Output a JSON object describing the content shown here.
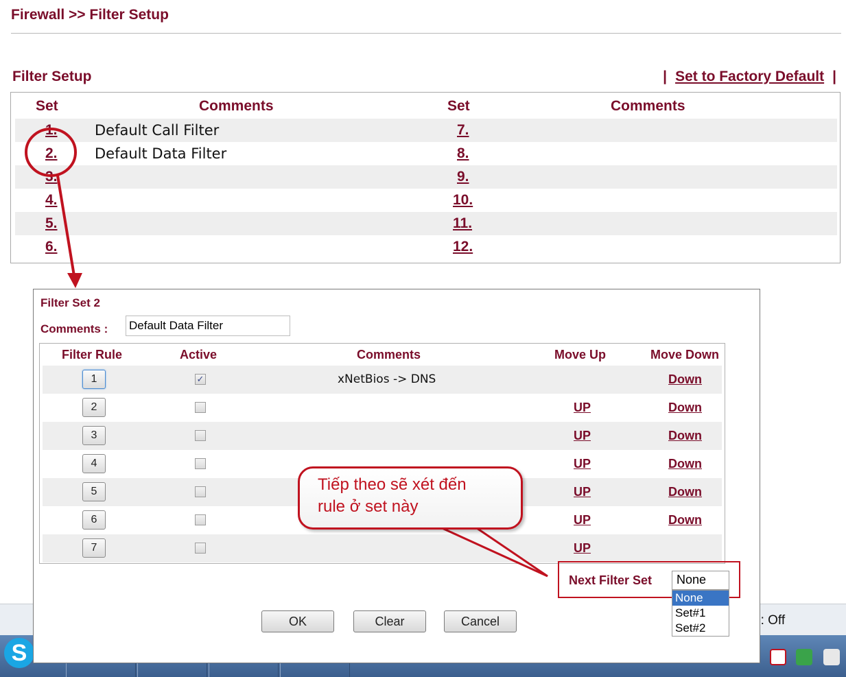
{
  "breadcrumb": "Firewall >> Filter Setup",
  "setup": {
    "heading": "Filter Setup",
    "sep_left": "|",
    "factory_link": "Set to Factory Default",
    "sep_right": "|",
    "col_set": "Set",
    "col_comments": "Comments",
    "left_rows": [
      {
        "set": "1.",
        "comment": "Default Call Filter"
      },
      {
        "set": "2.",
        "comment": "Default Data Filter"
      },
      {
        "set": "3.",
        "comment": ""
      },
      {
        "set": "4.",
        "comment": ""
      },
      {
        "set": "5.",
        "comment": ""
      },
      {
        "set": "6.",
        "comment": ""
      }
    ],
    "right_rows": [
      {
        "set": "7.",
        "comment": ""
      },
      {
        "set": "8.",
        "comment": ""
      },
      {
        "set": "9.",
        "comment": ""
      },
      {
        "set": "10.",
        "comment": ""
      },
      {
        "set": "11.",
        "comment": ""
      },
      {
        "set": "12.",
        "comment": ""
      }
    ]
  },
  "dialog": {
    "title": "Filter Set 2",
    "comments_label": "Comments :",
    "comments_value": "Default Data Filter",
    "headers": {
      "rule": "Filter Rule",
      "active": "Active",
      "comments": "Comments",
      "move_up": "Move Up",
      "move_down": "Move Down"
    },
    "rules": [
      {
        "num": "1",
        "active": true,
        "comment": "xNetBios -> DNS",
        "up": "",
        "down": "Down"
      },
      {
        "num": "2",
        "active": false,
        "comment": "",
        "up": "UP",
        "down": "Down"
      },
      {
        "num": "3",
        "active": false,
        "comment": "",
        "up": "UP",
        "down": "Down"
      },
      {
        "num": "4",
        "active": false,
        "comment": "",
        "up": "UP",
        "down": "Down"
      },
      {
        "num": "5",
        "active": false,
        "comment": "",
        "up": "UP",
        "down": "Down"
      },
      {
        "num": "6",
        "active": false,
        "comment": "",
        "up": "UP",
        "down": "Down"
      },
      {
        "num": "7",
        "active": false,
        "comment": "",
        "up": "UP",
        "down": ""
      }
    ],
    "next_filter_set_label": "Next Filter Set",
    "next_filter_set_value": "None",
    "next_filter_set_options": [
      "None",
      "Set#1",
      "Set#2"
    ],
    "ok": "OK",
    "clear": "Clear",
    "cancel": "Cancel"
  },
  "callout": {
    "line1": "Tiếp theo sẽ xét đến",
    "line2": "rule ở set này"
  },
  "status": {
    "text": "e: Off"
  },
  "colors": {
    "maroon": "#7a0d2a",
    "annotation_red": "#c0121f",
    "row_shade": "#eeeeee",
    "taskbar": "#4a6fa0"
  }
}
